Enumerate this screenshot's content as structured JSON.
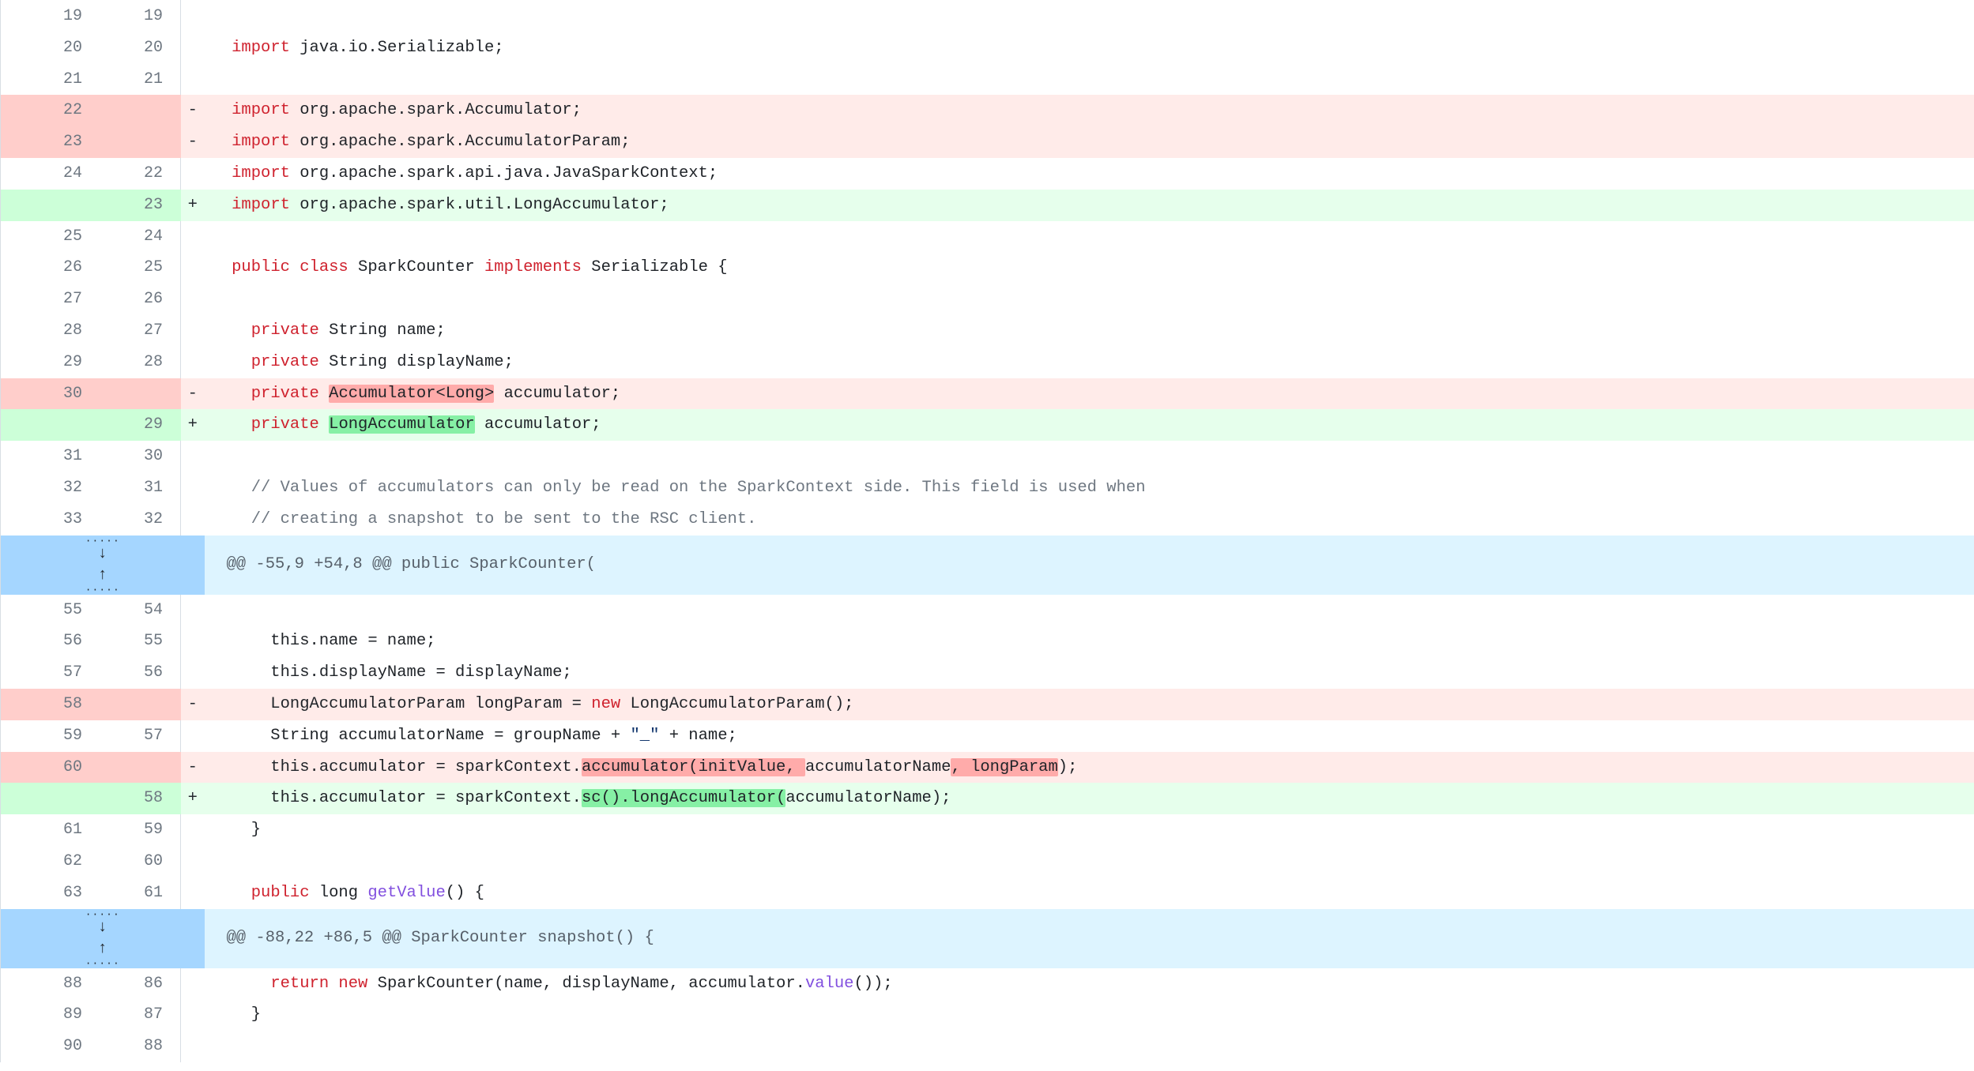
{
  "view": {
    "type": "unified-diff",
    "language": "java",
    "colors": {
      "deletion_line_bg": "#ffebe9",
      "deletion_gutter_bg": "#ffcecb",
      "deletion_word_bg": "#ffabaa",
      "addition_line_bg": "#e6ffec",
      "addition_gutter_bg": "#ccffd8",
      "addition_word_bg": "#86f0a5",
      "hunk_expander_bg": "#a5d6ff",
      "hunk_header_bg": "#ddf4ff",
      "context_bg": "#ffffff",
      "line_number_fg": "#6e7781",
      "keyword_fg": "#cf222e",
      "comment_fg": "#6e7781",
      "function_fg": "#8250df",
      "string_fg": "#0a3069",
      "text_fg": "#1f2328",
      "border": "#d8dee4"
    },
    "markers": {
      "deletion": "-",
      "addition": "+",
      "context": ""
    },
    "expander": {
      "name": "expand-hunk-button",
      "down_arrow": "↓",
      "up_arrow": "↑",
      "dots": "·····"
    }
  },
  "rows": [
    {
      "kind": "ctx",
      "old": "19",
      "new": "19",
      "marker": "",
      "tokens": []
    },
    {
      "kind": "ctx",
      "old": "20",
      "new": "20",
      "marker": "",
      "tokens": [
        {
          "t": "  ",
          "c": "pl"
        },
        {
          "t": "import",
          "c": "kw"
        },
        {
          "t": " java.io.Serializable;",
          "c": "pl"
        }
      ]
    },
    {
      "kind": "ctx",
      "old": "21",
      "new": "21",
      "marker": "",
      "tokens": []
    },
    {
      "kind": "del",
      "old": "22",
      "new": "",
      "marker": "-",
      "tokens": [
        {
          "t": "  ",
          "c": "pl"
        },
        {
          "t": "import",
          "c": "kw"
        },
        {
          "t": " org.apache.spark.Accumulator;",
          "c": "pl"
        }
      ]
    },
    {
      "kind": "del",
      "old": "23",
      "new": "",
      "marker": "-",
      "tokens": [
        {
          "t": "  ",
          "c": "pl"
        },
        {
          "t": "import",
          "c": "kw"
        },
        {
          "t": " org.apache.spark.AccumulatorParam;",
          "c": "pl"
        }
      ]
    },
    {
      "kind": "ctx",
      "old": "24",
      "new": "22",
      "marker": "",
      "tokens": [
        {
          "t": "  ",
          "c": "pl"
        },
        {
          "t": "import",
          "c": "kw"
        },
        {
          "t": " org.apache.spark.api.java.JavaSparkContext;",
          "c": "pl"
        }
      ]
    },
    {
      "kind": "add",
      "old": "",
      "new": "23",
      "marker": "+",
      "tokens": [
        {
          "t": "  ",
          "c": "pl"
        },
        {
          "t": "import",
          "c": "kw"
        },
        {
          "t": " org.apache.spark.util.LongAccumulator;",
          "c": "pl"
        }
      ]
    },
    {
      "kind": "ctx",
      "old": "25",
      "new": "24",
      "marker": "",
      "tokens": []
    },
    {
      "kind": "ctx",
      "old": "26",
      "new": "25",
      "marker": "",
      "tokens": [
        {
          "t": "  ",
          "c": "pl"
        },
        {
          "t": "public class",
          "c": "kw"
        },
        {
          "t": " SparkCounter ",
          "c": "pl"
        },
        {
          "t": "implements",
          "c": "kw"
        },
        {
          "t": " Serializable {",
          "c": "pl"
        }
      ]
    },
    {
      "kind": "ctx",
      "old": "27",
      "new": "26",
      "marker": "",
      "tokens": []
    },
    {
      "kind": "ctx",
      "old": "28",
      "new": "27",
      "marker": "",
      "tokens": [
        {
          "t": "    ",
          "c": "pl"
        },
        {
          "t": "private",
          "c": "kw"
        },
        {
          "t": " String name;",
          "c": "pl"
        }
      ]
    },
    {
      "kind": "ctx",
      "old": "29",
      "new": "28",
      "marker": "",
      "tokens": [
        {
          "t": "    ",
          "c": "pl"
        },
        {
          "t": "private",
          "c": "kw"
        },
        {
          "t": " String displayName;",
          "c": "pl"
        }
      ]
    },
    {
      "kind": "del",
      "old": "30",
      "new": "",
      "marker": "-",
      "tokens": [
        {
          "t": "    ",
          "c": "pl"
        },
        {
          "t": "private",
          "c": "kw"
        },
        {
          "t": " ",
          "c": "pl"
        },
        {
          "t": "Accumulator<Long>",
          "c": "pl",
          "hl": "del"
        },
        {
          "t": " accumulator;",
          "c": "pl"
        }
      ]
    },
    {
      "kind": "add",
      "old": "",
      "new": "29",
      "marker": "+",
      "tokens": [
        {
          "t": "    ",
          "c": "pl"
        },
        {
          "t": "private",
          "c": "kw"
        },
        {
          "t": " ",
          "c": "pl"
        },
        {
          "t": "LongAccumulator",
          "c": "pl",
          "hl": "add"
        },
        {
          "t": " accumulator;",
          "c": "pl"
        }
      ]
    },
    {
      "kind": "ctx",
      "old": "31",
      "new": "30",
      "marker": "",
      "tokens": []
    },
    {
      "kind": "ctx",
      "old": "32",
      "new": "31",
      "marker": "",
      "tokens": [
        {
          "t": "    // Values of accumulators can only be read on the SparkContext side. This field is used when",
          "c": "cmt"
        }
      ]
    },
    {
      "kind": "ctx",
      "old": "33",
      "new": "32",
      "marker": "",
      "tokens": [
        {
          "t": "    // creating a snapshot to be sent to the RSC client.",
          "c": "cmt"
        }
      ]
    },
    {
      "kind": "hunk",
      "header": "@@ -55,9 +54,8 @@ public SparkCounter("
    },
    {
      "kind": "ctx",
      "old": "55",
      "new": "54",
      "marker": "",
      "tokens": []
    },
    {
      "kind": "ctx",
      "old": "56",
      "new": "55",
      "marker": "",
      "tokens": [
        {
          "t": "      this.name = name;",
          "c": "pl"
        }
      ]
    },
    {
      "kind": "ctx",
      "old": "57",
      "new": "56",
      "marker": "",
      "tokens": [
        {
          "t": "      this.displayName = displayName;",
          "c": "pl"
        }
      ]
    },
    {
      "kind": "del",
      "old": "58",
      "new": "",
      "marker": "-",
      "tokens": [
        {
          "t": "      LongAccumulatorParam longParam = ",
          "c": "pl"
        },
        {
          "t": "new",
          "c": "kw"
        },
        {
          "t": " LongAccumulatorParam();",
          "c": "pl"
        }
      ]
    },
    {
      "kind": "ctx",
      "old": "59",
      "new": "57",
      "marker": "",
      "tokens": [
        {
          "t": "      String accumulatorName = groupName + ",
          "c": "pl"
        },
        {
          "t": "\"_\"",
          "c": "str"
        },
        {
          "t": " + name;",
          "c": "pl"
        }
      ]
    },
    {
      "kind": "del",
      "old": "60",
      "new": "",
      "marker": "-",
      "tokens": [
        {
          "t": "      this.accumulator = sparkContext.",
          "c": "pl"
        },
        {
          "t": "accumulator(initValue, ",
          "c": "pl",
          "hl": "del"
        },
        {
          "t": "accumulatorName",
          "c": "pl"
        },
        {
          "t": ", longParam",
          "c": "pl",
          "hl": "del"
        },
        {
          "t": ");",
          "c": "pl"
        }
      ]
    },
    {
      "kind": "add",
      "old": "",
      "new": "58",
      "marker": "+",
      "tokens": [
        {
          "t": "      this.accumulator = sparkContext.",
          "c": "pl"
        },
        {
          "t": "sc().longAccumulator(",
          "c": "pl",
          "hl": "add"
        },
        {
          "t": "accumulatorName);",
          "c": "pl"
        }
      ]
    },
    {
      "kind": "ctx",
      "old": "61",
      "new": "59",
      "marker": "",
      "tokens": [
        {
          "t": "    }",
          "c": "pl"
        }
      ]
    },
    {
      "kind": "ctx",
      "old": "62",
      "new": "60",
      "marker": "",
      "tokens": []
    },
    {
      "kind": "ctx",
      "old": "63",
      "new": "61",
      "marker": "",
      "tokens": [
        {
          "t": "    ",
          "c": "pl"
        },
        {
          "t": "public",
          "c": "kw"
        },
        {
          "t": " long ",
          "c": "pl"
        },
        {
          "t": "getValue",
          "c": "fn"
        },
        {
          "t": "() {",
          "c": "pl"
        }
      ]
    },
    {
      "kind": "hunk",
      "header": "@@ -88,22 +86,5 @@ SparkCounter snapshot() {"
    },
    {
      "kind": "ctx",
      "old": "88",
      "new": "86",
      "marker": "",
      "tokens": [
        {
          "t": "      ",
          "c": "pl"
        },
        {
          "t": "return new",
          "c": "kw"
        },
        {
          "t": " SparkCounter(name, displayName, accumulator.",
          "c": "pl"
        },
        {
          "t": "value",
          "c": "fn"
        },
        {
          "t": "());",
          "c": "pl"
        }
      ]
    },
    {
      "kind": "ctx",
      "old": "89",
      "new": "87",
      "marker": "",
      "tokens": [
        {
          "t": "    }",
          "c": "pl"
        }
      ]
    },
    {
      "kind": "ctx",
      "old": "90",
      "new": "88",
      "marker": "",
      "tokens": []
    }
  ]
}
